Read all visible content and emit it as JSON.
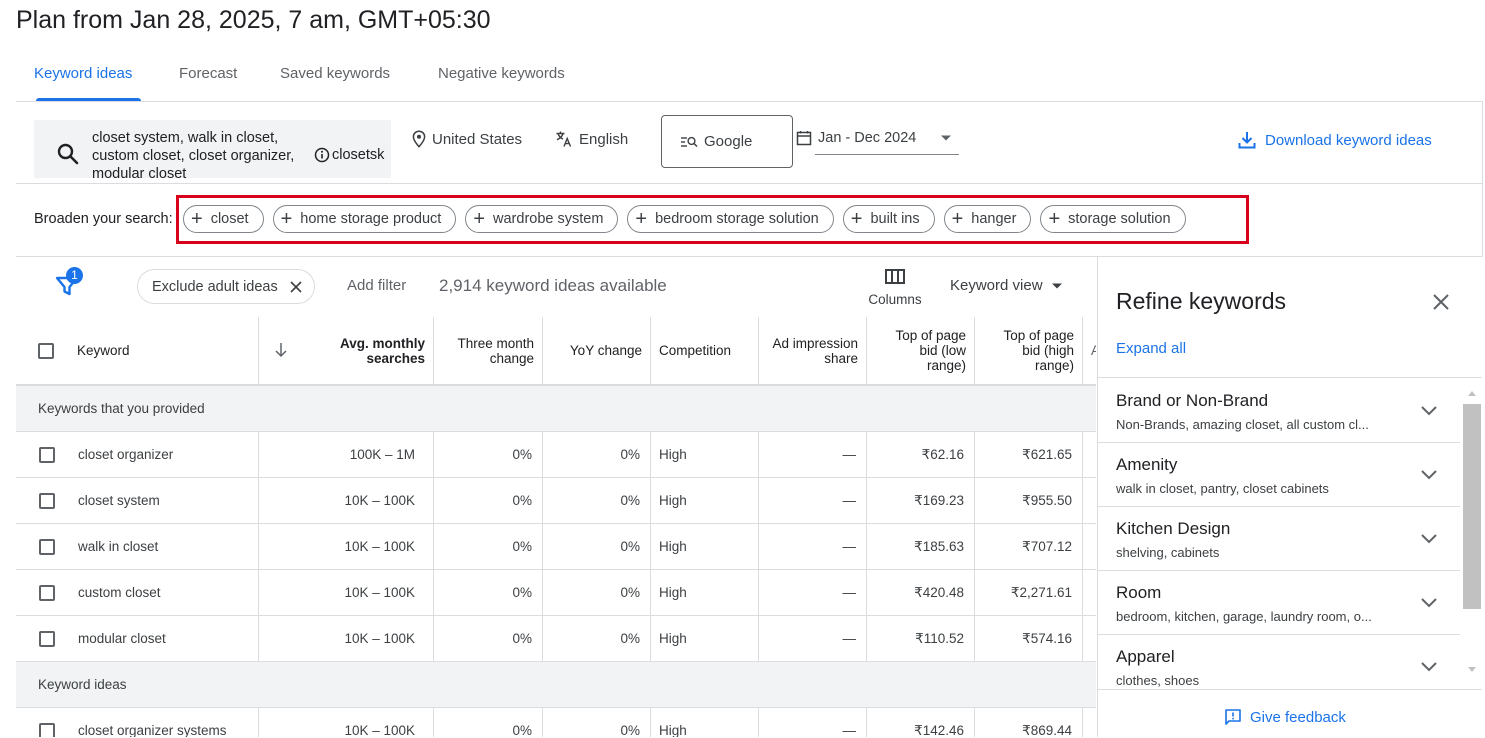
{
  "page_title": "Plan from Jan 28, 2025, 7 am, GMT+05:30",
  "tabs": [
    {
      "label": "Keyword ideas",
      "active": true
    },
    {
      "label": "Forecast"
    },
    {
      "label": "Saved keywords"
    },
    {
      "label": "Negative keywords"
    }
  ],
  "toolbar": {
    "search_text": "closet system, walk in closet, custom closet, closet organizer, modular closet",
    "search_extra": "closetsk",
    "location": "United States",
    "language": "English",
    "network": "Google",
    "date_range": "Jan - Dec 2024",
    "download_label": "Download keyword ideas"
  },
  "broaden": {
    "label": "Broaden your search:",
    "chips": [
      "closet",
      "home storage product",
      "wardrobe system",
      "bedroom storage solution",
      "built ins",
      "hanger",
      "storage solution"
    ]
  },
  "filter_bar": {
    "filter_count": "1",
    "exclude_chip": "Exclude adult ideas",
    "add_filter": "Add filter",
    "ideas_count": "2,914 keyword ideas available",
    "columns_label": "Columns",
    "keyword_view": "Keyword view"
  },
  "table": {
    "headers": {
      "keyword": "Keyword",
      "avg_monthly": "Avg. monthly searches",
      "three_month": "Three month change",
      "yoy": "YoY change",
      "competition": "Competition",
      "ad_impression": "Ad impression share",
      "bid_low": "Top of page bid (low range)",
      "bid_high": "Top of page bid (high range)",
      "next_col": "A"
    },
    "sections": [
      {
        "title": "Keywords that you provided",
        "rows": [
          {
            "keyword": "closet organizer",
            "searches": "100K – 1M",
            "three_month": "0%",
            "yoy": "0%",
            "competition": "High",
            "impression": "—",
            "bid_low": "₹62.16",
            "bid_high": "₹621.65"
          },
          {
            "keyword": "closet system",
            "searches": "10K – 100K",
            "three_month": "0%",
            "yoy": "0%",
            "competition": "High",
            "impression": "—",
            "bid_low": "₹169.23",
            "bid_high": "₹955.50"
          },
          {
            "keyword": "walk in closet",
            "searches": "10K – 100K",
            "three_month": "0%",
            "yoy": "0%",
            "competition": "High",
            "impression": "—",
            "bid_low": "₹185.63",
            "bid_high": "₹707.12"
          },
          {
            "keyword": "custom closet",
            "searches": "10K – 100K",
            "three_month": "0%",
            "yoy": "0%",
            "competition": "High",
            "impression": "—",
            "bid_low": "₹420.48",
            "bid_high": "₹2,271.61"
          },
          {
            "keyword": "modular closet",
            "searches": "10K – 100K",
            "three_month": "0%",
            "yoy": "0%",
            "competition": "High",
            "impression": "—",
            "bid_low": "₹110.52",
            "bid_high": "₹574.16"
          }
        ]
      },
      {
        "title": "Keyword ideas",
        "rows": [
          {
            "keyword": "closet organizer systems",
            "searches": "10K – 100K",
            "three_month": "0%",
            "yoy": "0%",
            "competition": "High",
            "impression": "—",
            "bid_low": "₹142.46",
            "bid_high": "₹869.44"
          }
        ]
      }
    ]
  },
  "refine": {
    "title": "Refine keywords",
    "expand_all": "Expand all",
    "items": [
      {
        "name": "Brand or Non-Brand",
        "sub": "Non-Brands, amazing closet, all custom cl..."
      },
      {
        "name": "Amenity",
        "sub": "walk in closet, pantry, closet cabinets"
      },
      {
        "name": "Kitchen Design",
        "sub": "shelving, cabinets"
      },
      {
        "name": "Room",
        "sub": "bedroom, kitchen, garage, laundry room, o..."
      },
      {
        "name": "Apparel",
        "sub": "clothes, shoes"
      }
    ],
    "feedback_label": "Give feedback"
  },
  "colors": {
    "accent": "#1a73e8",
    "highlight": "#d9001b"
  }
}
